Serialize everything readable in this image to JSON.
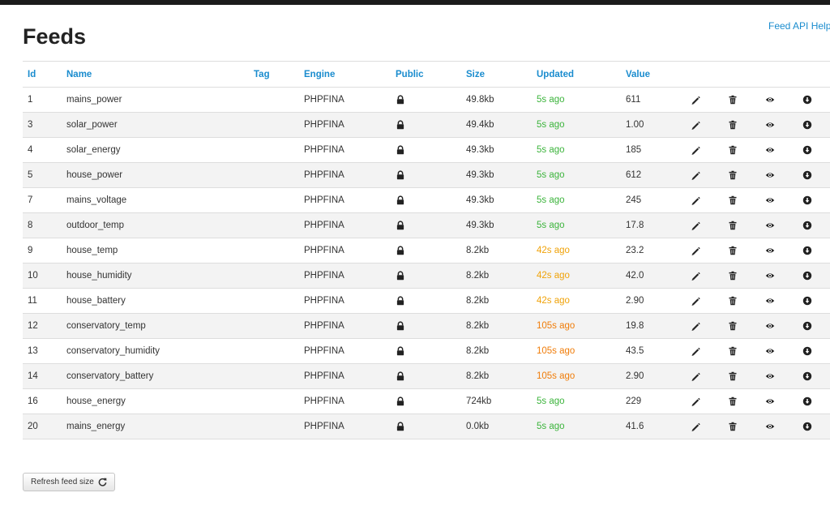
{
  "page": {
    "title": "Feeds",
    "help_link": "Feed API Help"
  },
  "table": {
    "headers": {
      "id": "Id",
      "name": "Name",
      "tag": "Tag",
      "engine": "Engine",
      "public": "Public",
      "size": "Size",
      "updated": "Updated",
      "value": "Value"
    },
    "rows": [
      {
        "id": "1",
        "name": "mains_power",
        "tag": "",
        "engine": "PHPFINA",
        "size": "49.8kb",
        "updated": "5s ago",
        "updated_status": "green",
        "value": "611"
      },
      {
        "id": "3",
        "name": "solar_power",
        "tag": "",
        "engine": "PHPFINA",
        "size": "49.4kb",
        "updated": "5s ago",
        "updated_status": "green",
        "value": "1.00"
      },
      {
        "id": "4",
        "name": "solar_energy",
        "tag": "",
        "engine": "PHPFINA",
        "size": "49.3kb",
        "updated": "5s ago",
        "updated_status": "green",
        "value": "185"
      },
      {
        "id": "5",
        "name": "house_power",
        "tag": "",
        "engine": "PHPFINA",
        "size": "49.3kb",
        "updated": "5s ago",
        "updated_status": "green",
        "value": "612"
      },
      {
        "id": "7",
        "name": "mains_voltage",
        "tag": "",
        "engine": "PHPFINA",
        "size": "49.3kb",
        "updated": "5s ago",
        "updated_status": "green",
        "value": "245"
      },
      {
        "id": "8",
        "name": "outdoor_temp",
        "tag": "",
        "engine": "PHPFINA",
        "size": "49.3kb",
        "updated": "5s ago",
        "updated_status": "green",
        "value": "17.8"
      },
      {
        "id": "9",
        "name": "house_temp",
        "tag": "",
        "engine": "PHPFINA",
        "size": "8.2kb",
        "updated": "42s ago",
        "updated_status": "yellow",
        "value": "23.2"
      },
      {
        "id": "10",
        "name": "house_humidity",
        "tag": "",
        "engine": "PHPFINA",
        "size": "8.2kb",
        "updated": "42s ago",
        "updated_status": "yellow",
        "value": "42.0"
      },
      {
        "id": "11",
        "name": "house_battery",
        "tag": "",
        "engine": "PHPFINA",
        "size": "8.2kb",
        "updated": "42s ago",
        "updated_status": "yellow",
        "value": "2.90"
      },
      {
        "id": "12",
        "name": "conservatory_temp",
        "tag": "",
        "engine": "PHPFINA",
        "size": "8.2kb",
        "updated": "105s ago",
        "updated_status": "orange",
        "value": "19.8"
      },
      {
        "id": "13",
        "name": "conservatory_humidity",
        "tag": "",
        "engine": "PHPFINA",
        "size": "8.2kb",
        "updated": "105s ago",
        "updated_status": "orange",
        "value": "43.5"
      },
      {
        "id": "14",
        "name": "conservatory_battery",
        "tag": "",
        "engine": "PHPFINA",
        "size": "8.2kb",
        "updated": "105s ago",
        "updated_status": "orange",
        "value": "2.90"
      },
      {
        "id": "16",
        "name": "house_energy",
        "tag": "",
        "engine": "PHPFINA",
        "size": "724kb",
        "updated": "5s ago",
        "updated_status": "green",
        "value": "229"
      },
      {
        "id": "20",
        "name": "mains_energy",
        "tag": "",
        "engine": "PHPFINA",
        "size": "0.0kb",
        "updated": "5s ago",
        "updated_status": "green",
        "value": "41.6"
      }
    ],
    "row_icons": [
      "lock-icon",
      "pencil-icon",
      "trash-icon",
      "eye-icon",
      "download-icon"
    ]
  },
  "buttons": {
    "refresh_label": "Refresh feed size",
    "refresh_icon": "refresh-icon"
  },
  "colors": {
    "link": "#1a8cce",
    "updated_green": "#3cb43c",
    "updated_yellow": "#f0a30a",
    "updated_orange": "#f07d0a",
    "stripe": "#f3f3f3"
  }
}
